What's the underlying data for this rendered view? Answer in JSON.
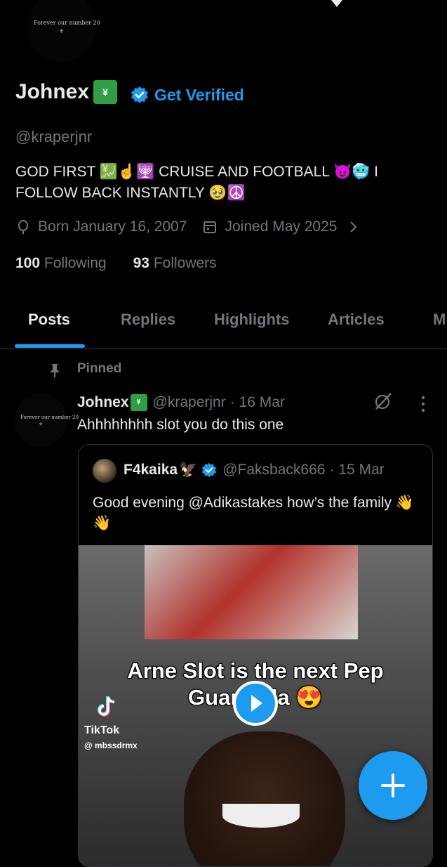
{
  "profile": {
    "avatar_text": "Forever our number 20",
    "name": "Johnex",
    "verify_label": "Get Verified",
    "handle": "@kraperjnr",
    "bio": "GOD FIRST 💹☝️🕎 CRUISE AND FOOTBALL 😈🥶 I FOLLOW BACK INSTANTLY 🥹☮️",
    "born": "Born January 16, 2007",
    "joined": "Joined May 2025",
    "following_count": "100",
    "following_label": "Following",
    "followers_count": "93",
    "followers_label": "Followers"
  },
  "tabs": [
    {
      "label": "Posts",
      "active": true
    },
    {
      "label": "Replies"
    },
    {
      "label": "Highlights"
    },
    {
      "label": "Articles"
    },
    {
      "label": "M"
    }
  ],
  "post": {
    "pinned_label": "Pinned",
    "author": "Johnex",
    "handle": "@kraperjnr",
    "date": "· 16 Mar",
    "text": "Ahhhhhhhh slot you do this one",
    "quote": {
      "author": "F4kaika",
      "author_emoji": "🦅",
      "handle": "@Faksback666",
      "date": "· 15 Mar",
      "text": "Good evening @Adikastakes how’s the family 👋👋",
      "overlay_text": "Arne Slot is the next Pep Guardiola 😍",
      "tiktok_label": "TikTok",
      "tiktok_user": "@ mbssdrmx"
    }
  },
  "colors": {
    "accent": "#1d9bf0",
    "background": "#000000",
    "text": "#e7e9ea",
    "muted": "#71767b",
    "border": "#2f3336"
  },
  "icons": [
    "balloon-icon",
    "calendar-icon",
    "chevron-right-icon",
    "verified-badge-icon",
    "pin-icon",
    "grok-icon",
    "more-icon",
    "play-icon",
    "plus-icon"
  ]
}
